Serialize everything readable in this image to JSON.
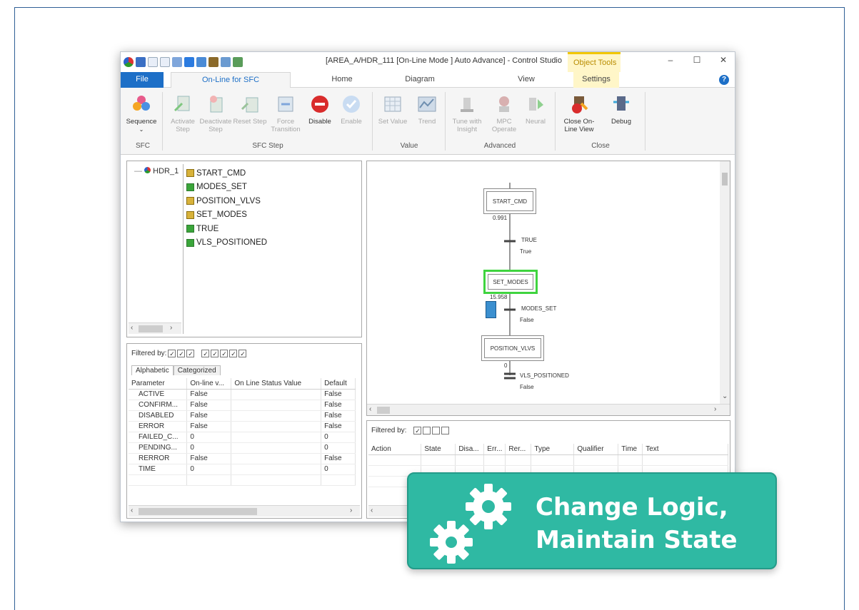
{
  "window": {
    "title": "[AREA_A/HDR_111 [On-Line Mode ] Auto Advance] - Control Studio",
    "context_tab": "Object Tools",
    "minimize": "–",
    "maximize": "☐",
    "close": "✕"
  },
  "tabs": {
    "file": "File",
    "online_sfc": "On-Line for SFC",
    "home": "Home",
    "diagram": "Diagram",
    "view": "View",
    "settings": "Settings",
    "help": "?"
  },
  "ribbon": {
    "sequence": "Sequence",
    "activate_step": "Activate Step",
    "deactivate_step": "Deactivate Step",
    "reset_step": "Reset Step",
    "force_transition": "Force Transition",
    "disable": "Disable",
    "enable": "Enable",
    "set_value": "Set Value",
    "trend": "Trend",
    "tune_insight": "Tune with Insight",
    "mpc_operate": "MPC Operate",
    "neural": "Neural",
    "close_online": "Close On-Line View",
    "debug": "Debug",
    "groups": {
      "sfc": "SFC",
      "sfc_step": "SFC Step",
      "value": "Value",
      "advanced": "Advanced",
      "close": "Close"
    }
  },
  "tree": {
    "root": "HDR_1",
    "items": [
      {
        "label": "START_CMD",
        "color": "yellow"
      },
      {
        "label": "MODES_SET",
        "color": "green"
      },
      {
        "label": "POSITION_VLVS",
        "color": "yellow"
      },
      {
        "label": "SET_MODES",
        "color": "yellow"
      },
      {
        "label": "TRUE",
        "color": "green"
      },
      {
        "label": "VLS_POSITIONED",
        "color": "green"
      }
    ]
  },
  "params": {
    "filtered_by": "Filtered by:",
    "tab_alphabetic": "Alphabetic",
    "tab_categorized": "Categorized",
    "headers": [
      "Parameter",
      "On-line v...",
      "On Line Status Value",
      "Default"
    ],
    "rows": [
      [
        "ACTIVE",
        "False",
        "",
        "False"
      ],
      [
        "CONFIRM...",
        "False",
        "",
        "False"
      ],
      [
        "DISABLED",
        "False",
        "",
        "False"
      ],
      [
        "ERROR",
        "False",
        "",
        "False"
      ],
      [
        "FAILED_C...",
        "0",
        "",
        "0"
      ],
      [
        "PENDING...",
        "0",
        "",
        "0"
      ],
      [
        "RERROR",
        "False",
        "",
        "False"
      ],
      [
        "TIME",
        "0",
        "",
        "0"
      ]
    ]
  },
  "diagram": {
    "step1": "START_CMD",
    "step1_time": "0.991",
    "trans1": "TRUE",
    "trans1_state": "True",
    "step2": "SET_MODES",
    "step2_time": "15.958",
    "trans2": "MODES_SET",
    "trans2_state": "False",
    "step3": "POSITION_VLVS",
    "step3_time": "0",
    "trans3": "VLS_POSITIONED",
    "trans3_state": "False"
  },
  "actions": {
    "filtered_by": "Filtered by:",
    "headers": [
      "Action",
      "State",
      "Disa...",
      "Err...",
      "Rer...",
      "Type",
      "Qualifier",
      "Time",
      "Text"
    ]
  },
  "badge": {
    "line1": "Change Logic,",
    "line2": "Maintain State",
    "color": "#2fb9a3"
  }
}
